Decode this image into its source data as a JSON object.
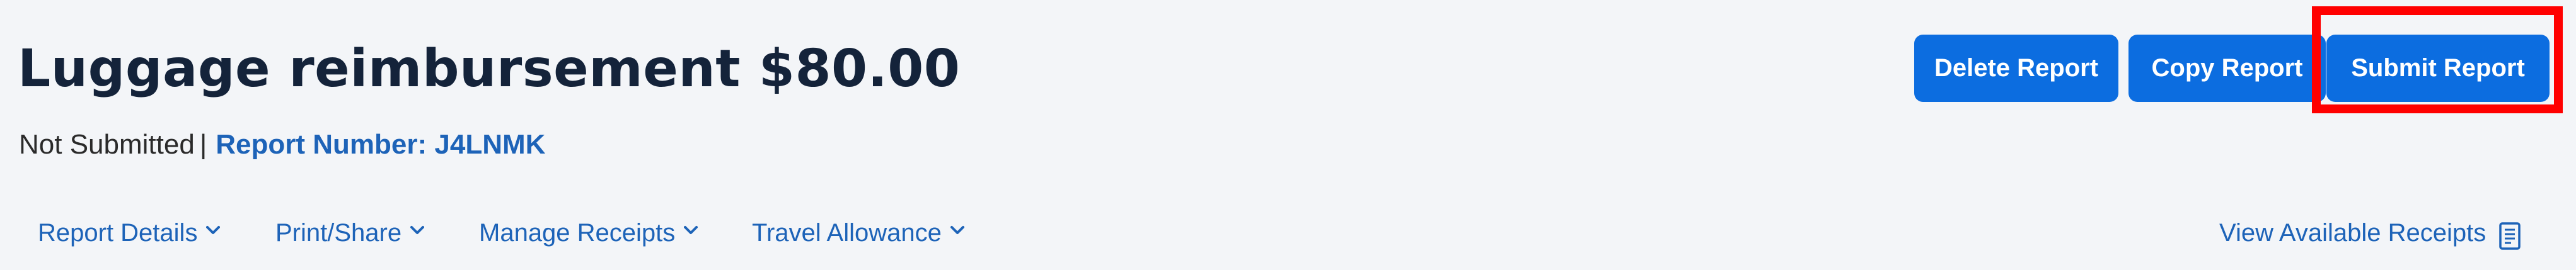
{
  "header": {
    "title": "Luggage reimbursement $80.00",
    "status": "Not Submitted",
    "separator": "|",
    "report_number_label": "Report Number: J4LNMK"
  },
  "actions": {
    "delete_label": "Delete Report",
    "copy_label": "Copy Report",
    "submit_label": "Submit Report"
  },
  "nav": {
    "items": [
      {
        "label": "Report Details"
      },
      {
        "label": "Print/Share"
      },
      {
        "label": "Manage Receipts"
      },
      {
        "label": "Travel Allowance"
      }
    ],
    "right_label": "View Available Receipts"
  },
  "icons": {
    "dropdown": "chevron-down-icon",
    "receipts": "receipt-icon"
  },
  "colors": {
    "primary_button": "#0c6de0",
    "link": "#1d63b8",
    "title": "#14233a",
    "highlight": "#ff0000",
    "background": "#f3f5f8"
  }
}
